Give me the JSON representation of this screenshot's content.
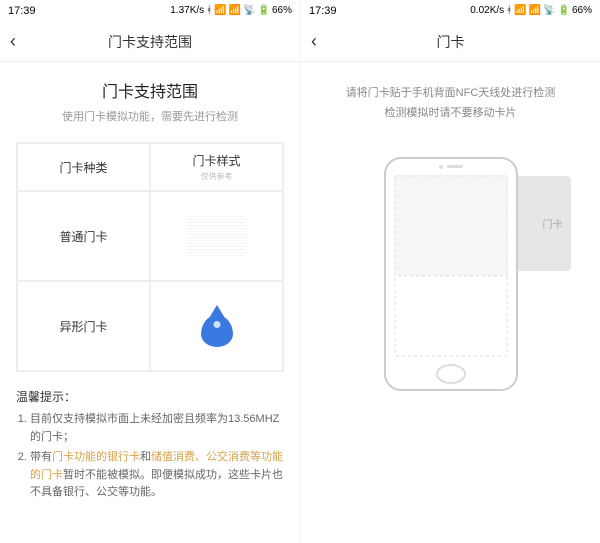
{
  "left": {
    "statusbar": {
      "time": "17:39",
      "net": "1.37K/s",
      "battery": "66%"
    },
    "header": {
      "title": "门卡支持范围"
    },
    "section": {
      "title": "门卡支持范围",
      "subtitle": "使用门卡模拟功能，需要先进行检测"
    },
    "table": {
      "h1": "门卡种类",
      "h2": "门卡样式",
      "h2_sub": "仅供参考",
      "r1": "普通门卡",
      "r2": "异形门卡"
    },
    "tips": {
      "title": "温馨提示：",
      "t1": "目前仅支持模拟市面上未经加密且频率为13.56MHZ的门卡；",
      "t2a": "带有",
      "t2_hl1": "门卡功能的银行卡",
      "t2b": "和",
      "t2_hl2": "储值消费、公交消费等功能的门卡",
      "t2c": "暂时不能被模拟。即便模拟成功，这些卡片也不具备银行、公交等功能。"
    }
  },
  "right": {
    "statusbar": {
      "time": "17:39",
      "net": "0.02K/s",
      "battery": "66%"
    },
    "header": {
      "title": "门卡"
    },
    "instruction": {
      "l1": "请将门卡贴于手机背面NFC天线处进行检测",
      "l2": "检测模拟时请不要移动卡片"
    },
    "card_label": "门卡"
  }
}
